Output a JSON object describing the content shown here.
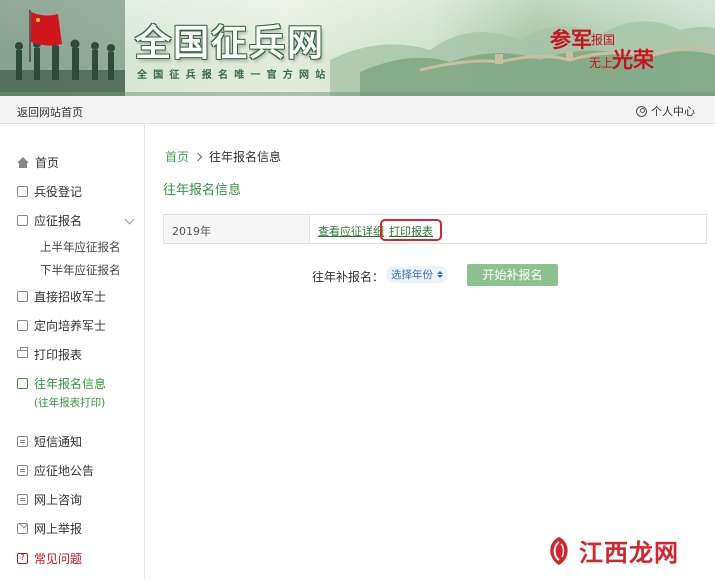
{
  "banner": {
    "logo_text": "全国征兵网",
    "subtitle": "全国征兵报名唯一官方网站",
    "slogan": [
      "参军",
      "报国",
      "无上",
      "光荣"
    ],
    "colors": {
      "green": "#2f9a3c",
      "red": "#c8151d"
    }
  },
  "topbar": {
    "back_label": "返回网站首页",
    "user_label": "个人中心"
  },
  "sidebar": {
    "items": [
      {
        "label": "首页",
        "icon": "home-icon"
      },
      {
        "label": "兵役登记",
        "icon": "document-icon"
      },
      {
        "label": "应征报名",
        "icon": "form-icon"
      },
      {
        "label": "上半年应征报名"
      },
      {
        "label": "下半年应征报名"
      },
      {
        "label": "直接招收军士",
        "icon": "document-icon"
      },
      {
        "label": "定向培养军士",
        "icon": "document-icon"
      },
      {
        "label": "打印报表",
        "icon": "printer-icon"
      },
      {
        "label": "往年报名信息",
        "icon": "document-icon",
        "note": "(往年报表打印)"
      },
      {
        "label": "短信通知",
        "icon": "chat-icon"
      },
      {
        "label": "应征地公告",
        "icon": "chat-icon"
      },
      {
        "label": "网上咨询",
        "icon": "chat-icon"
      },
      {
        "label": "网上举报",
        "icon": "mail-icon"
      },
      {
        "label": "常见问题",
        "icon": "question-icon"
      }
    ]
  },
  "main": {
    "breadcrumb": {
      "home": "首页",
      "current": "往年报名信息"
    },
    "title": "往年报名信息",
    "row": {
      "year": "2019年",
      "view_link": "查看应征详细",
      "print_link": "打印报表"
    },
    "supplement": {
      "label": "往年补报名：",
      "select_value": "选择年份",
      "button": "开始补报名"
    }
  },
  "watermark": {
    "text": "江西龙网"
  }
}
